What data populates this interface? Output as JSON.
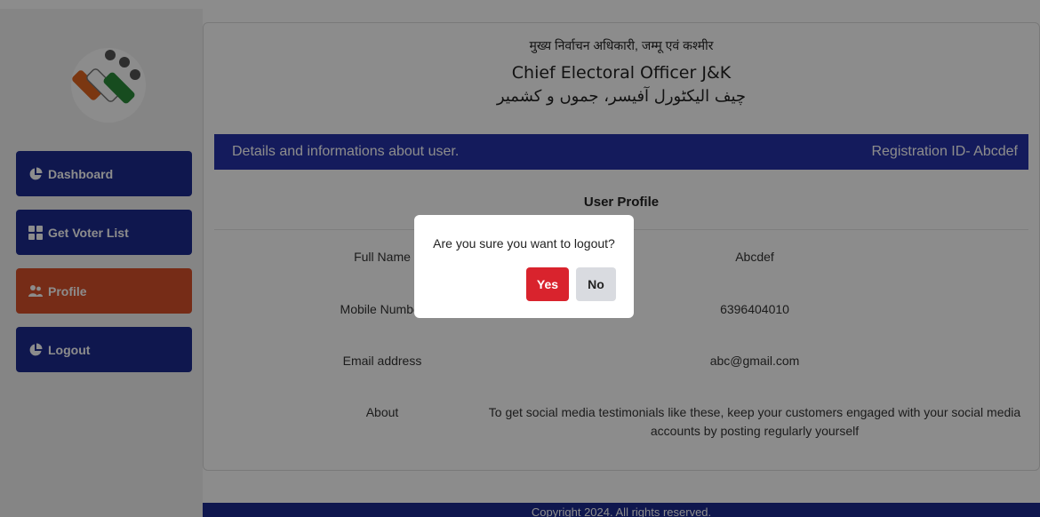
{
  "colors": {
    "nav_blue": "#1c2a8f",
    "nav_active": "#d8502a",
    "banner": "#2632a8",
    "yes_button": "#d9232d",
    "no_button": "#d9dbe0"
  },
  "sidebar": {
    "logo_icon": "eci-logo",
    "items": [
      {
        "label": "Dashboard",
        "icon": "pie-chart-icon",
        "active": false
      },
      {
        "label": "Get Voter List",
        "icon": "grid-icon",
        "active": false
      },
      {
        "label": "Profile",
        "icon": "users-icon",
        "active": true
      },
      {
        "label": "Logout",
        "icon": "pie-chart-icon",
        "active": false
      }
    ]
  },
  "header": {
    "hindi": "मुख्य निर्वाचन अधिकारी, जम्मू एवं कश्मीर",
    "english": "Chief Electoral Officer J&K",
    "urdu": "چیف الیکٹورل آفیسر، جموں و کشمیر"
  },
  "banner": {
    "left": "Details and informations about user.",
    "right": "Registration ID- Abcdef"
  },
  "profile": {
    "title": "User Profile",
    "rows": [
      {
        "label": "Full Name",
        "value": "Abcdef"
      },
      {
        "label": "Mobile Number",
        "value": "6396404010"
      },
      {
        "label": "Email address",
        "value": "abc@gmail.com"
      },
      {
        "label": "About",
        "value": "To get social media testimonials like these, keep your customers engaged with your social media accounts by posting regularly yourself"
      }
    ]
  },
  "footer": {
    "text": "Copyright 2024. All rights reserved."
  },
  "modal": {
    "message": "Are you sure you want to logout?",
    "yes_label": "Yes",
    "no_label": "No"
  }
}
